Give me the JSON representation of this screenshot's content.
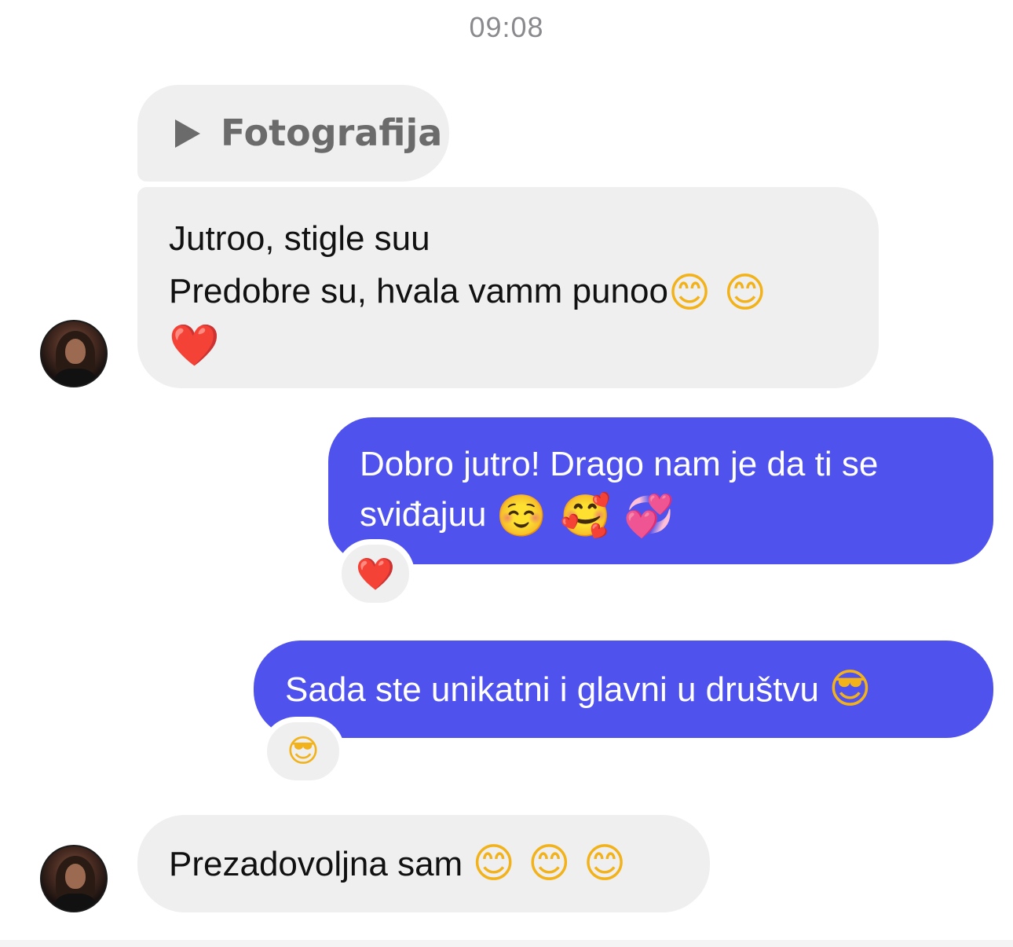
{
  "chat": {
    "timestamp": "09:08",
    "messages": [
      {
        "sender": "contact",
        "type": "photo",
        "label": "Fotografija"
      },
      {
        "sender": "contact",
        "type": "text",
        "lines": [
          "Jutroo, stigle suu",
          "Predobre su, hvala vamm punoo"
        ],
        "emoji_line2": "😊 😊",
        "emoji_line3": "❤️"
      },
      {
        "sender": "me",
        "type": "text",
        "lines": [
          "Dobro jutro! Drago nam je da ti se",
          "sviđajuu"
        ],
        "emoji_line2": "☺️ 🥰 💞",
        "reaction": "❤️"
      },
      {
        "sender": "me",
        "type": "text",
        "text": "Sada ste unikatni i glavni u društvu",
        "emoji": "😎",
        "reaction": "😎"
      },
      {
        "sender": "contact",
        "type": "text",
        "text": "Prezadovoljna sam",
        "emoji": "😊 😊 😊"
      }
    ]
  },
  "icons": {
    "play": "play-icon",
    "avatar": "contact-avatar"
  },
  "colors": {
    "incoming_bubble": "#efefef",
    "outgoing_bubble": "#5052ee",
    "timestamp": "#8a8a8e",
    "photo_label": "#6b6b6b"
  }
}
